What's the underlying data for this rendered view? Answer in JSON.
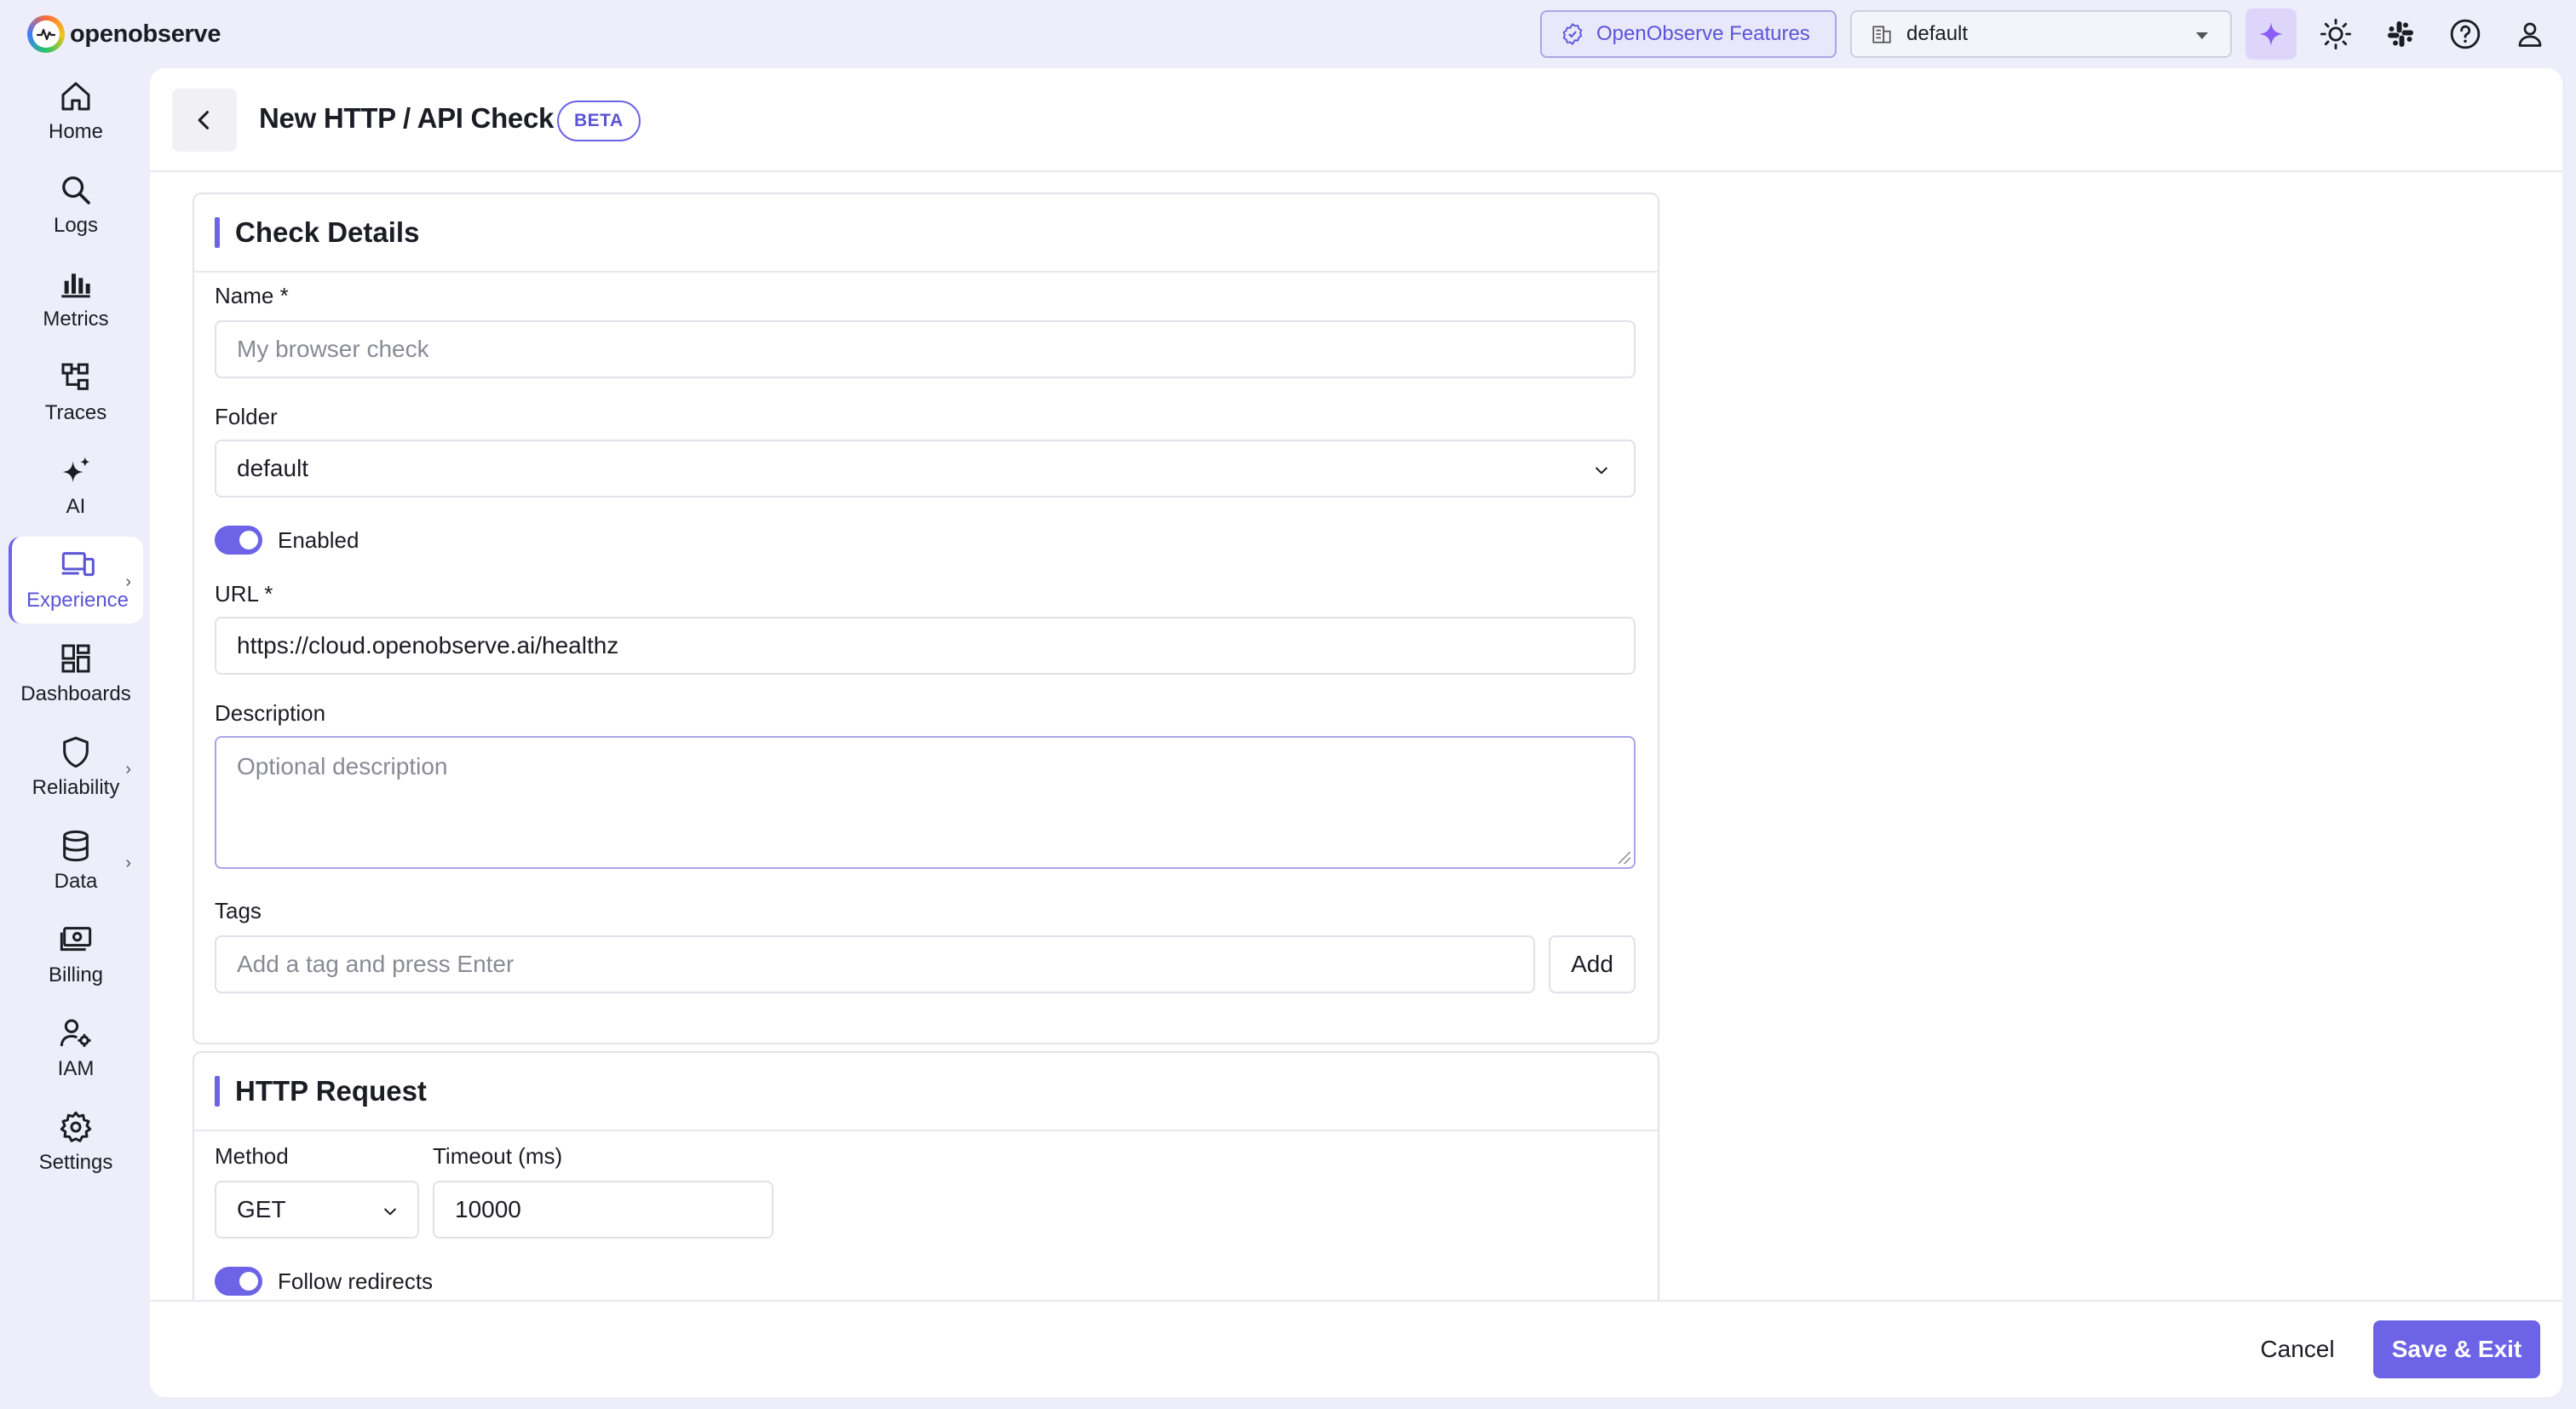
{
  "app": {
    "logo_text": "openobserve",
    "features_label": "OpenObserve Features",
    "org_selected": "default"
  },
  "colors": {
    "accent": "#6c63e6",
    "background": "#eeeefa"
  },
  "sidebar": {
    "items": [
      {
        "label": "Home",
        "icon": "home-icon"
      },
      {
        "label": "Logs",
        "icon": "search-icon"
      },
      {
        "label": "Metrics",
        "icon": "bar-chart-icon"
      },
      {
        "label": "Traces",
        "icon": "traces-icon"
      },
      {
        "label": "AI",
        "icon": "sparkles-icon"
      },
      {
        "label": "Experience",
        "icon": "devices-icon",
        "active": true
      },
      {
        "label": "Dashboards",
        "icon": "dashboard-icon"
      },
      {
        "label": "Reliability",
        "icon": "shield-icon"
      },
      {
        "label": "Data",
        "icon": "database-icon"
      },
      {
        "label": "Billing",
        "icon": "billing-icon"
      },
      {
        "label": "IAM",
        "icon": "user-gear-icon"
      },
      {
        "label": "Settings",
        "icon": "gear-icon"
      }
    ]
  },
  "page": {
    "title": "New HTTP / API Check",
    "badge": "BETA"
  },
  "check_details": {
    "section_title": "Check Details",
    "name_label": "Name *",
    "name_placeholder": "My browser check",
    "folder_label": "Folder",
    "folder_value": "default",
    "enabled_label": "Enabled",
    "url_label": "URL *",
    "url_value": "https://cloud.openobserve.ai/healthz",
    "description_label": "Description",
    "description_placeholder": "Optional description",
    "tags_label": "Tags",
    "tags_placeholder": "Add a tag and press Enter",
    "add_label": "Add"
  },
  "http_request": {
    "section_title": "HTTP Request",
    "method_label": "Method",
    "method_value": "GET",
    "timeout_label": "Timeout (ms)",
    "timeout_value": "10000",
    "follow_redirects_label": "Follow redirects"
  },
  "footer": {
    "cancel_label": "Cancel",
    "save_label": "Save & Exit"
  }
}
